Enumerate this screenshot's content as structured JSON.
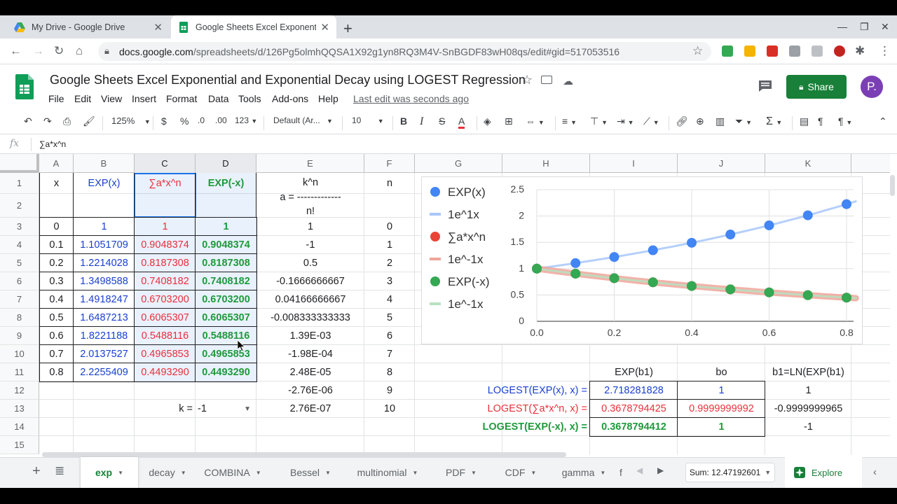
{
  "browser": {
    "tabs": [
      {
        "title": "My Drive - Google Drive",
        "active": false
      },
      {
        "title": "Google Sheets Excel Exponential",
        "active": true
      }
    ],
    "url_host": "docs.google.com",
    "url_path": "/spreadsheets/d/126Pg5olmhQQSA1X92g1yn8RQ3M4V-SnBGDF83wH08qs/edit#gid=517053516"
  },
  "doc": {
    "title": "Google Sheets Excel Exponential and Exponential Decay using LOGEST Regression",
    "menus": [
      "File",
      "Edit",
      "View",
      "Insert",
      "Format",
      "Data",
      "Tools",
      "Add-ons",
      "Help"
    ],
    "last_edit": "Last edit was seconds ago",
    "share_label": "Share",
    "avatar_letter": "P."
  },
  "toolbar": {
    "zoom": "125%",
    "currency": "$",
    "percent": "%",
    "dec_less": ".0",
    "dec_more": ".00",
    "format_123": "123",
    "font": "Default (Ar...",
    "font_size": "10",
    "bold": "B",
    "italic": "I",
    "strike": "S",
    "text_color": "A"
  },
  "formula_bar": {
    "fx": "fx",
    "content": "∑a*x^n"
  },
  "columns": [
    "A",
    "B",
    "C",
    "D",
    "E",
    "F",
    "G",
    "H",
    "I",
    "J",
    "K"
  ],
  "rows": [
    "1",
    "2",
    "3",
    "4",
    "5",
    "6",
    "7",
    "8",
    "9",
    "10",
    "11",
    "12",
    "13",
    "14",
    "15"
  ],
  "headers": {
    "a": "x",
    "b": "EXP(x)",
    "c": "∑a*x^n",
    "d": "EXP(-x)",
    "e_top": "k^n",
    "e_mid": "a = -------------",
    "e_bot": "n!",
    "f": "n"
  },
  "table": {
    "x": [
      "0",
      "0.1",
      "0.2",
      "0.3",
      "0.4",
      "0.5",
      "0.6",
      "0.7",
      "0.8"
    ],
    "expx": [
      "1",
      "1.1051709",
      "1.2214028",
      "1.3498588",
      "1.4918247",
      "1.6487213",
      "1.8221188",
      "2.0137527",
      "2.2255409"
    ],
    "sum": [
      "1",
      "0.9048374",
      "0.8187308",
      "0.7408182",
      "0.6703200",
      "0.6065307",
      "0.5488116",
      "0.4965853",
      "0.4493290"
    ],
    "expnx": [
      "1",
      "0.9048374",
      "0.8187308",
      "0.7408182",
      "0.6703200",
      "0.6065307",
      "0.5488116",
      "0.4965853",
      "0.4493290"
    ],
    "a": [
      "1",
      "-1",
      "0.5",
      "-0.1666666667",
      "0.04166666667",
      "-0.008333333333",
      "1.39E-03",
      "-1.98E-04",
      "2.48E-05",
      "-2.76E-06",
      "2.76E-07"
    ],
    "n": [
      "0",
      "1",
      "2",
      "3",
      "4",
      "5",
      "6",
      "7",
      "8",
      "9",
      "10"
    ]
  },
  "k_label": "k =",
  "k_value": "-1",
  "logest": {
    "hdr_i": "EXP(b1)",
    "hdr_j": "bo",
    "hdr_k": "b1=LN(EXP(b1)",
    "rows": [
      {
        "label": "LOGEST(EXP(x), x) =",
        "i": "2.718281828",
        "j": "1",
        "k": "1"
      },
      {
        "label": "LOGEST(∑a*x^n, x) =",
        "i": "0.3678794425",
        "j": "0.9999999992",
        "k": "-0.9999999965"
      },
      {
        "label": "LOGEST(EXP(-x), x) =",
        "i": "0.3678794412",
        "j": "1",
        "k": "-1"
      }
    ]
  },
  "colors": {
    "blue": "#1a3fd1",
    "red": "#e8303a",
    "green": "#1f9a3c",
    "share": "#188038"
  },
  "chart_data": {
    "type": "scatter",
    "x": [
      0,
      0.1,
      0.2,
      0.3,
      0.4,
      0.5,
      0.6,
      0.7,
      0.8
    ],
    "series": [
      {
        "name": "EXP(x)",
        "kind": "points",
        "color": "#4285f4",
        "values": [
          1,
          1.1051709,
          1.2214028,
          1.3498588,
          1.4918247,
          1.6487213,
          1.8221188,
          2.0137527,
          2.2255409
        ]
      },
      {
        "name": "1e^1x",
        "kind": "trend",
        "color": "#a8c7fa",
        "k": 1
      },
      {
        "name": "∑a*x^n",
        "kind": "points",
        "color": "#ea4335",
        "values": [
          1,
          0.9048374,
          0.8187308,
          0.7408182,
          0.67032,
          0.6065307,
          0.5488116,
          0.4965853,
          0.449329
        ]
      },
      {
        "name": "1e^-1x",
        "kind": "trend",
        "color": "#f0a59a",
        "k": -1
      },
      {
        "name": "EXP(-x)",
        "kind": "points",
        "color": "#34a853",
        "values": [
          1,
          0.9048374,
          0.8187308,
          0.7408182,
          0.67032,
          0.6065307,
          0.5488116,
          0.4965853,
          0.449329
        ]
      },
      {
        "name": "1e^-1x",
        "kind": "trend",
        "color": "#b7e1c1",
        "k": -1
      }
    ],
    "x_ticks": [
      "0.0",
      "0.2",
      "0.4",
      "0.6",
      "0.8"
    ],
    "y_ticks": [
      "0",
      "0.5",
      "1",
      "1.5",
      "2",
      "2.5"
    ],
    "xlim": [
      0,
      0.8
    ],
    "ylim": [
      0,
      2.5
    ],
    "grid": true,
    "legend": "left"
  },
  "sheet_tabs": [
    "exp",
    "decay",
    "COMBINA",
    "Bessel",
    "multinomial",
    "PDF",
    "CDF",
    "gamma",
    "f"
  ],
  "sum_label": "Sum: 12.47192601",
  "explore_label": "Explore"
}
